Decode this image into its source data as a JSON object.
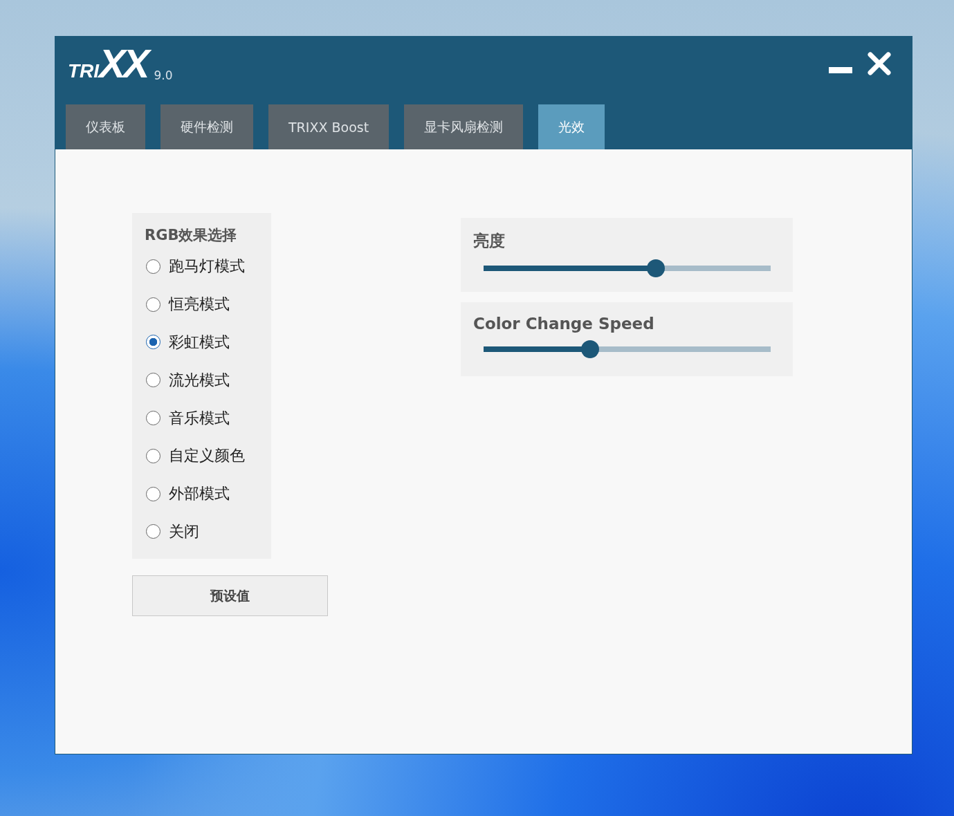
{
  "window": {
    "logo_prefix": "TRI",
    "logo_main": "XX",
    "version": "9.0"
  },
  "tabs": [
    {
      "label": "仪表板",
      "selected": false
    },
    {
      "label": "硬件检测",
      "selected": false
    },
    {
      "label": "TRIXX Boost",
      "selected": false
    },
    {
      "label": "显卡风扇检测",
      "selected": false
    },
    {
      "label": "光效",
      "selected": true
    }
  ],
  "rgb_effects": {
    "title": "RGB效果选择",
    "options": [
      {
        "label": "跑马灯模式",
        "selected": false
      },
      {
        "label": "恒亮模式",
        "selected": false
      },
      {
        "label": "彩虹模式",
        "selected": true
      },
      {
        "label": "流光模式",
        "selected": false
      },
      {
        "label": "音乐模式",
        "selected": false
      },
      {
        "label": "自定义颜色",
        "selected": false
      },
      {
        "label": "外部模式",
        "selected": false
      },
      {
        "label": "关闭",
        "selected": false
      }
    ]
  },
  "preset_button": "预设值",
  "sliders": [
    {
      "label": "亮度",
      "level": 0.6
    },
    {
      "label": "Color Change Speed",
      "level": 0.37
    }
  ]
}
